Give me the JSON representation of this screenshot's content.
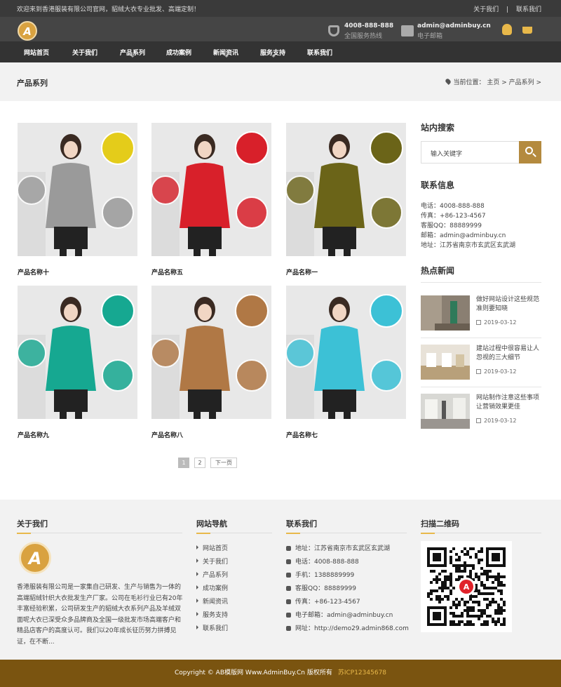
{
  "topbar": {
    "welcome": "欢迎来到香港服装有限公司官网，貂绒大衣专业批发、高端定制！",
    "link_about": "关于我们",
    "separator": "|",
    "link_contact": "联系我们"
  },
  "header": {
    "logo_letter": "A",
    "hotline_number": "4008-888-888",
    "hotline_label": "全国服务热线",
    "email": "admin@adminbuy.cn",
    "email_label": "电子邮箱"
  },
  "nav": {
    "items": [
      {
        "label": "网站首页"
      },
      {
        "label": "关于我们"
      },
      {
        "label": "产品系列"
      },
      {
        "label": "成功案例"
      },
      {
        "label": "新闻资讯"
      },
      {
        "label": "服务支持"
      },
      {
        "label": "联系我们"
      }
    ]
  },
  "band": {
    "title": "产品系列",
    "breadcrumb": "当前位置： 主页 > 产品系列 >"
  },
  "products": [
    {
      "name": "产品名称十",
      "coat": "#9a9a9a",
      "accent": "#e4cc1a"
    },
    {
      "name": "产品名称五",
      "coat": "#d8202a",
      "accent": "#d8202a"
    },
    {
      "name": "产品名称一",
      "coat": "#6b6418",
      "accent": "#6b6418"
    },
    {
      "name": "产品名称九",
      "coat": "#16a891",
      "accent": "#16a891"
    },
    {
      "name": "产品名称八",
      "coat": "#b07845",
      "accent": "#b07845"
    },
    {
      "name": "产品名称七",
      "coat": "#3cc1d6",
      "accent": "#3cc1d6"
    }
  ],
  "pager": {
    "page1": "1",
    "page2": "2",
    "next": "下一页"
  },
  "sidebar": {
    "search_title": "站内搜索",
    "search_placeholder": "输入关键字",
    "contact_title": "联系信息",
    "contact_lines": [
      "电话：4008-888-888",
      "传真：+86-123-4567",
      "客服QQ：88889999",
      "邮箱：admin@adminbuy.cn",
      "地址：江苏省南京市玄武区玄武湖"
    ],
    "news_title": "热点新闻",
    "news": [
      {
        "title": "做好网站设计这些规范准则要知晓",
        "date": "2019-03-12"
      },
      {
        "title": "建站过程中很容易让人忽视的三大细节",
        "date": "2019-03-12"
      },
      {
        "title": "网站制作注意这些事项让营销效果更佳",
        "date": "2019-03-12"
      }
    ]
  },
  "footer": {
    "about_title": "关于我们",
    "about_text": "香港服装有限公司是一家集自己研发、生产与销售为一体的高端貂绒针织大衣批发生产厂家。公司在毛衫行业已有20年丰富经验积累，公司研发生产的貂绒大衣系列产品及羊绒双面呢大衣已深受众多品牌商及全国一级批发市场高端客户和精品店客户的高度认可。我们以20年成长征历努力拼搏见证，在不断...",
    "nav_title": "网站导航",
    "nav_items": [
      "网站首页",
      "关于我们",
      "产品系列",
      "成功案例",
      "新闻资讯",
      "服务支持",
      "联系我们"
    ],
    "contact_title": "联系我们",
    "contact_items": [
      "地址：江苏省南京市玄武区玄武湖",
      "电话：4008-888-888",
      "手机：1388889999",
      "客服QQ：88889999",
      "传真：+86-123-4567",
      "电子邮箱：admin@adminbuy.cn",
      "网址：http://demo29.admin868.com"
    ],
    "qr_title": "扫描二维码"
  },
  "copyright": {
    "text": "Copyright © AB模版网 Www.AdminBuy.Cn 版权所有",
    "icp": "苏ICP12345678"
  }
}
